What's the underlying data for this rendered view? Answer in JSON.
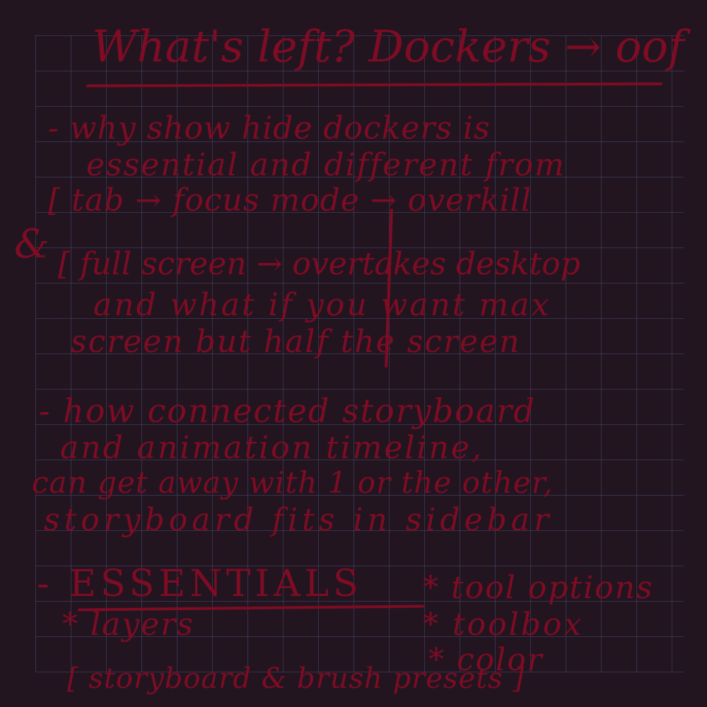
{
  "note": {
    "title": "What's left? Dockers → oof",
    "lines": [
      "- why show hide dockers is",
      "essential and different from",
      "[ tab → focus mode → overkill",
      "&",
      "[ full screen → overtakes desktop",
      "and what if you want max",
      "screen but half the screen",
      "- how connected storyboard",
      "and animation timeline,",
      "can get away with 1 or the other,",
      "storyboard fits in sidebar",
      "- ESSENTIALS",
      "* tool options",
      "* layers",
      "* toolbox",
      "* color",
      "[ storyboard & brush presets ]"
    ]
  },
  "colors": {
    "background": "#221520",
    "grid": "#464a6e",
    "ink": "#7d0c24"
  }
}
